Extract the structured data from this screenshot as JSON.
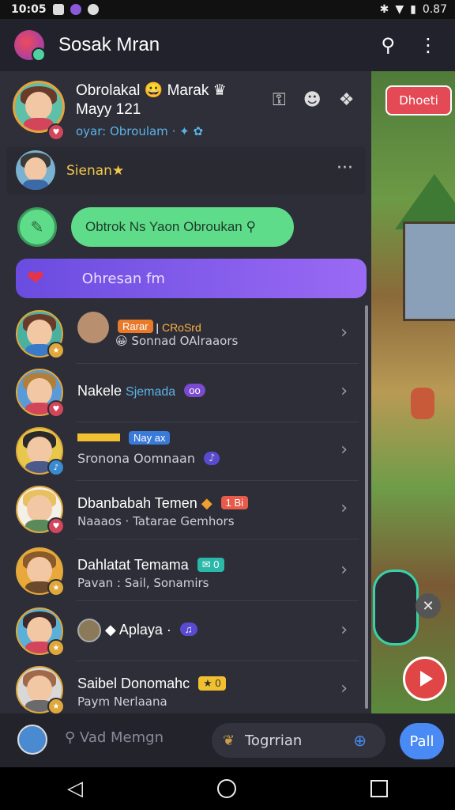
{
  "status_bar": {
    "time": "10:05",
    "battery": "0.87"
  },
  "app_bar": {
    "title": "Sosak Mran",
    "icons": [
      "profile-icon",
      "more-vertical-icon"
    ]
  },
  "header_card": {
    "name": "Obrolakal",
    "name_suffix": "Marak",
    "subtitle": "Mayy 121",
    "status": "oyar: Obroulam"
  },
  "friend_card": {
    "name": "Sienan"
  },
  "bubble_green": {
    "text": "Obtrok Ns Yaon Obroukan"
  },
  "bubble_purple": {
    "text": "Ohresan fm"
  },
  "rows": [
    {
      "title_tag1": "Rarar",
      "title_tag2": "CRoSrd",
      "sub": "Sonnad OAlraaors"
    },
    {
      "title": "Nakele",
      "title_extra": "Sjemada",
      "sub": ""
    },
    {
      "title_tag": "Nay ax",
      "sub": "Sronona Oomnaan"
    },
    {
      "title": "Dbanbabah Temen",
      "tag": "1 Bi",
      "sub": "Naaaos · Tatarae Gemhors"
    },
    {
      "title": "Dahlatat Temama",
      "tag": "0",
      "sub": "Pavan : Sail, Sonamirs"
    },
    {
      "title": "Aplaya",
      "sub": ""
    },
    {
      "title": "Saibel Donomahc",
      "tag": "0",
      "sub": "Paym  Nerlaana"
    }
  ],
  "game": {
    "badge": "Dhoeti"
  },
  "bottom_bar": {
    "search_placeholder": "Vad Memgn",
    "input_text": "Togrrian",
    "button_label": "Pall"
  },
  "colors": {
    "accent": "#4a8af5",
    "panel": "#2e2e38",
    "purple_bubble": "#7a5aec",
    "green_bubble": "#5fdc8a"
  }
}
